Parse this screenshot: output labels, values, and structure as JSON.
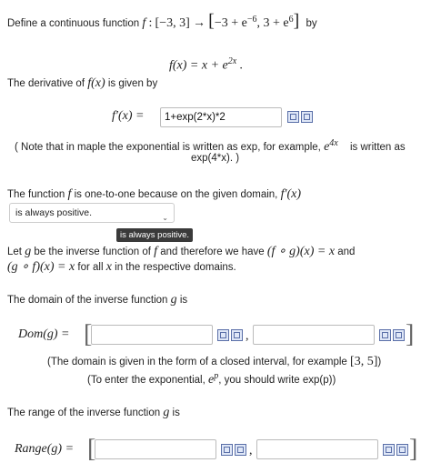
{
  "intro": {
    "text": "Define a continuous function",
    "f": "f",
    "colon": ":",
    "domain": "[−3, 3]",
    "arrow": "→",
    "codomain_open": "[",
    "codomain": "−3 + e",
    "exp1": "−6",
    "codomain_mid": ", 3 + e",
    "exp2": "6",
    "codomain_close": "]",
    "by": "by"
  },
  "function_def": {
    "lhs": "f(x) = x + e",
    "exp": "2x",
    "period": "."
  },
  "derivative_intro": {
    "text": "The derivative of",
    "fx": "f(x)",
    "rest": "is given by"
  },
  "derivative": {
    "lhs": "f′(x) =",
    "answer": "1+exp(2*x)*2"
  },
  "note": {
    "line1": "( Note that in maple the exponential is written as exp, for example,",
    "e": "e",
    "exp": "4x",
    "line1_end": "is written as",
    "line2": "exp(4*x). )"
  },
  "one_to_one": {
    "text": "The function",
    "f": "f",
    "rest": "is one-to-one because on the given domain,",
    "fprime": "f′(x)"
  },
  "dropdown": {
    "selected": "is always positive.",
    "chevron": "⌄"
  },
  "tooltip": "is always positive.",
  "inverse": {
    "t1": "Let",
    "g": "g",
    "t2": "be the inverse function of",
    "f": "f",
    "t3": "and therefore we have",
    "eq1": "(f ∘ g)(x) = x",
    "and": "and",
    "eq2": "(g ∘ f)(x) = x",
    "t4": "for all",
    "x": "x",
    "t5": "in the respective domains."
  },
  "domain_q": {
    "text": "The domain of the inverse function",
    "g": "g",
    "is": "is"
  },
  "dom_row": {
    "label": "Dom(g) =",
    "open": "[",
    "sep": ",",
    "close": "]",
    "left": "",
    "right": ""
  },
  "dom_note1": {
    "text": "(The domain is given in the form of a closed interval, for example",
    "example": "[3, 5]",
    "close": ")"
  },
  "dom_note2": {
    "text": "(To enter the exponential,",
    "e": "e",
    "p": "p",
    "rest": ", you should write exp(p))"
  },
  "range_q": {
    "text": "The range of the inverse function",
    "g": "g",
    "is": "is"
  },
  "range_row": {
    "label": "Range(g) =",
    "open": "[",
    "sep": ",",
    "close": "]",
    "left": "",
    "right": ""
  }
}
